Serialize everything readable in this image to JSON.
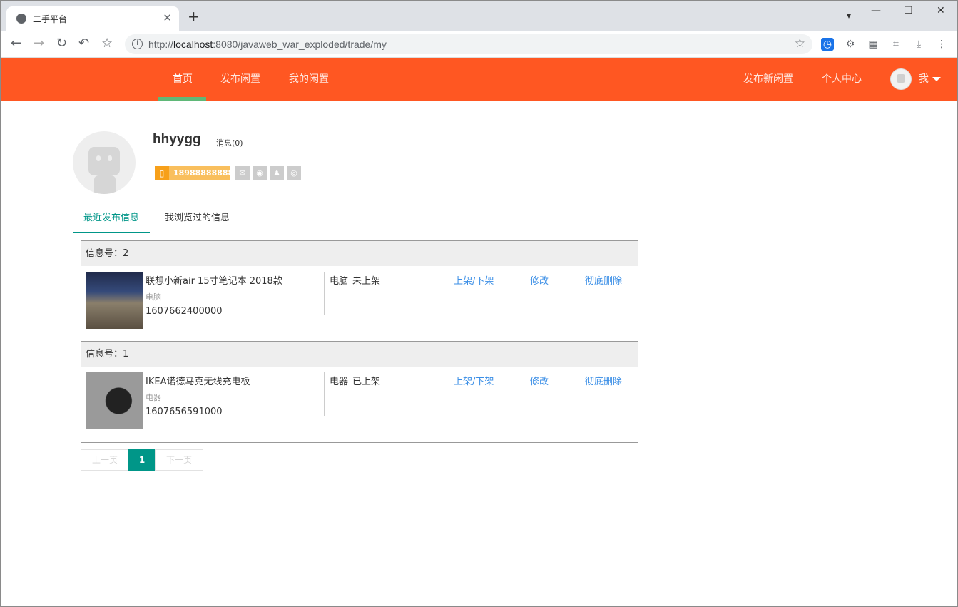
{
  "browser": {
    "tab_title": "二手平台",
    "tab_close": "✕",
    "new_tab": "+",
    "url_prefix": "http://",
    "url_host": "localhost",
    "url_rest": ":8080/javaweb_war_exploded/trade/my",
    "win_min": "—",
    "win_max": "☐",
    "win_close": "✕",
    "tab_dropdown": "▾"
  },
  "site_nav": {
    "items": [
      "首页",
      "发布闲置",
      "我的闲置"
    ],
    "right_items": [
      "发布新闲置",
      "个人中心"
    ],
    "user_label": "我"
  },
  "profile": {
    "username": "hhyygg",
    "messages": "消息(0)",
    "phone": "18988888888"
  },
  "tabs": [
    "最近发布信息",
    "我浏览过的信息"
  ],
  "list": {
    "items": [
      {
        "head": "信息号：2",
        "title": "联想小新air 15寸笔记本 2018款",
        "category": "电脑",
        "time": "1607662400000",
        "status_cat": "电脑",
        "status": "未上架",
        "action_toggle": "上架/下架",
        "action_edit": "修改",
        "action_delete": "彻底删除"
      },
      {
        "head": "信息号：1",
        "title": "IKEA诺德马克无线充电板",
        "category": "电器",
        "time": "1607656591000",
        "status_cat": "电器",
        "status": "已上架",
        "action_toggle": "上架/下架",
        "action_edit": "修改",
        "action_delete": "彻底删除"
      }
    ]
  },
  "pagination": {
    "prev": "上一页",
    "current": "1",
    "next": "下一页"
  },
  "colors": {
    "header": "#ff5722",
    "accent": "#009688",
    "link": "#3a8ee6",
    "nav_active_bar": "#5fb878"
  }
}
